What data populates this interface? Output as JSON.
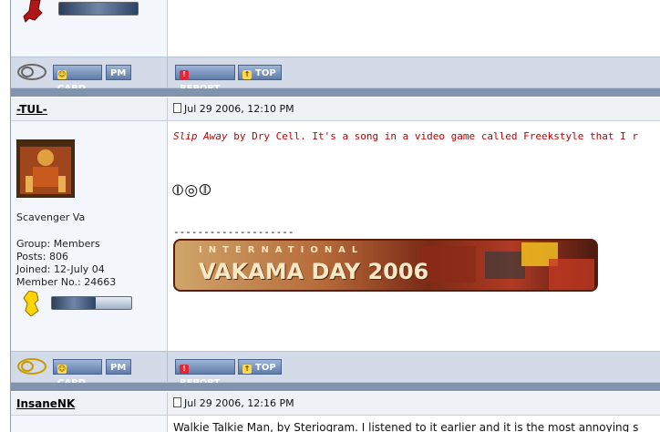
{
  "buttons": {
    "card": "CARD",
    "pm": "PM",
    "report": "REPORT",
    "top": "TOP"
  },
  "post1": {
    "username": "-TUL-",
    "date": "Jul 29 2006, 12:10 PM",
    "title": "Scavenger Va",
    "group": "Group: Members",
    "posts": "Posts: 806",
    "joined": "Joined: 12-July 04",
    "member_no": "Member No.: 24663",
    "level_fraction": 0.55,
    "message": {
      "song_title": "Slip Away",
      "rest": " by Dry Cell. It's a song in a video game called Freekstyle that I r"
    },
    "symbols": "⦶◎⦷",
    "divider": "--------------------",
    "banner": {
      "top_text": "INTERNATIONAL",
      "main_text": "VAKAMA DAY 2006"
    }
  },
  "post2": {
    "username": "InsaneNK",
    "date": "Jul 29 2006, 12:16 PM",
    "message": "Walkie Talkie Man, by Steriogram. I listened to it earlier and it is the most annoying s"
  },
  "colors": {
    "toolbar": "#d3dbe8",
    "separator": "#8293ad",
    "button": "#5f7ba8",
    "song": "#c00000"
  }
}
